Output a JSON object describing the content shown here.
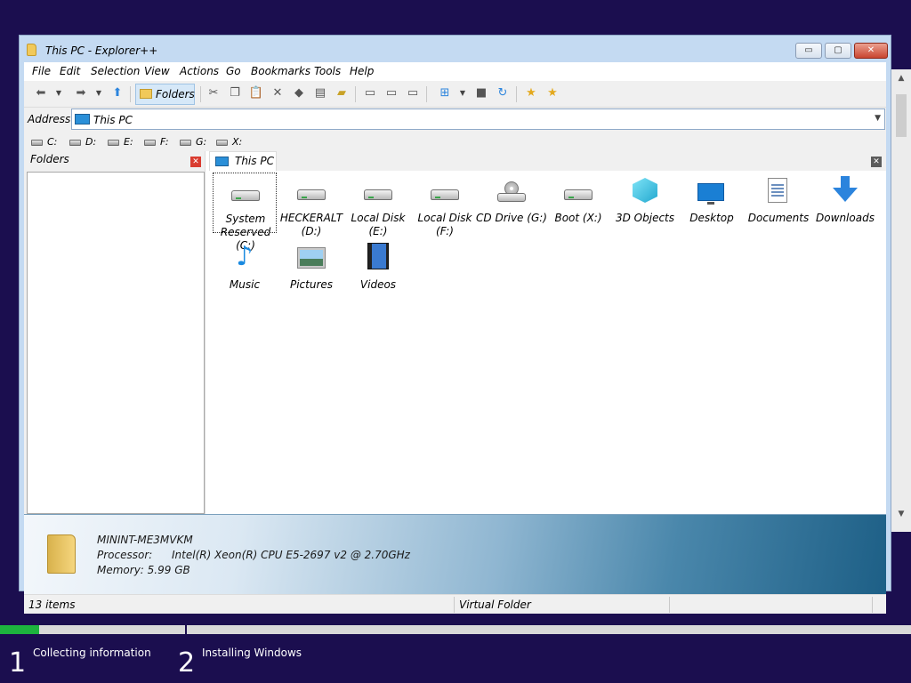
{
  "window": {
    "title": "This PC - Explorer++",
    "buttons": {
      "minimize": "▭",
      "maximize": "▢",
      "close": "✕"
    }
  },
  "menu": [
    "File",
    "Edit",
    "Selection",
    "View",
    "Actions",
    "Go",
    "Bookmarks",
    "Tools",
    "Help"
  ],
  "toolbar": {
    "folders_label": "Folders",
    "icons": [
      "back-arrow-icon",
      "forward-arrow-icon",
      "up-arrow-icon",
      "folders-icon",
      "cut-icon",
      "copy-icon",
      "paste-icon",
      "delete-icon",
      "delete-permanently-icon",
      "properties-icon",
      "search-icon",
      "copy-to-icon",
      "move-to-icon",
      "new-folder-icon",
      "views-icon",
      "command-prompt-icon",
      "refresh-icon",
      "bookmark-add-icon",
      "bookmarks-icon"
    ]
  },
  "address": {
    "label": "Address",
    "value": "This PC"
  },
  "drives": [
    "C:",
    "D:",
    "E:",
    "F:",
    "G:",
    "X:"
  ],
  "folders_pane": {
    "title": "Folders"
  },
  "tab": {
    "label": "This PC"
  },
  "items": [
    {
      "label": "System Reserved (C:)",
      "icon": "drive-icon"
    },
    {
      "label": "HECKERALT (D:)",
      "icon": "drive-icon"
    },
    {
      "label": "Local Disk (E:)",
      "icon": "drive-icon"
    },
    {
      "label": "Local Disk (F:)",
      "icon": "drive-icon"
    },
    {
      "label": "CD Drive (G:)",
      "icon": "cd-drive-icon"
    },
    {
      "label": "Boot (X:)",
      "icon": "drive-icon"
    },
    {
      "label": "3D Objects",
      "icon": "3d-objects-icon"
    },
    {
      "label": "Desktop",
      "icon": "desktop-icon"
    },
    {
      "label": "Documents",
      "icon": "documents-icon"
    },
    {
      "label": "Downloads",
      "icon": "downloads-icon"
    },
    {
      "label": "Music",
      "icon": "music-icon"
    },
    {
      "label": "Pictures",
      "icon": "pictures-icon"
    },
    {
      "label": "Videos",
      "icon": "videos-icon"
    }
  ],
  "info": {
    "computer_name": "MININT-ME3MVKM",
    "processor_label": "Processor:",
    "processor_value": "Intel(R) Xeon(R) CPU E5-2697 v2 @ 2.70GHz",
    "memory": "Memory: 5.99 GB"
  },
  "status": {
    "count": "13 items",
    "type": "Virtual Folder"
  },
  "setup": {
    "progress_fraction": 0.043,
    "accent": "#1db33e",
    "steps": [
      {
        "number": "1",
        "label": "Collecting information"
      },
      {
        "number": "2",
        "label": "Installing Windows"
      }
    ]
  }
}
